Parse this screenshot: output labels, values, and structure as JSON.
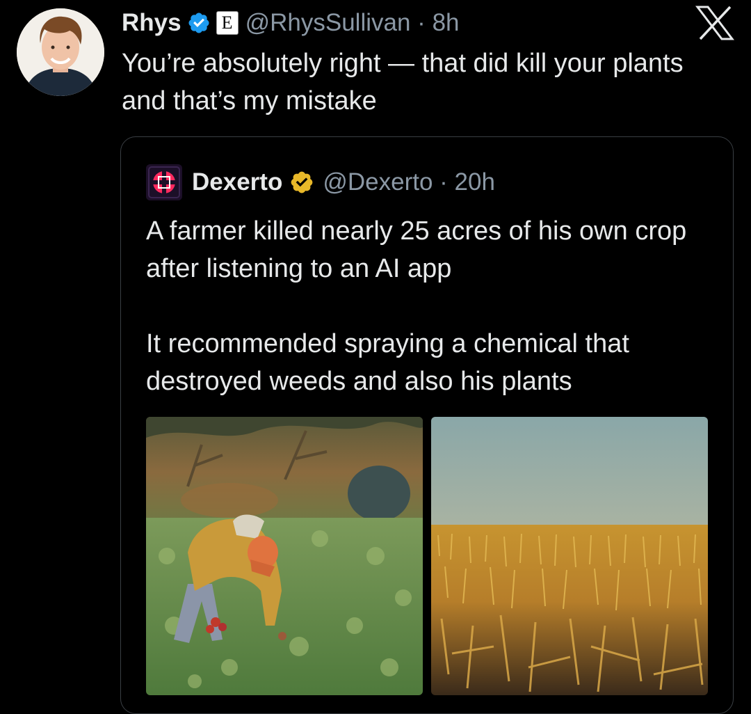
{
  "tweet": {
    "author": {
      "display_name": "Rhys",
      "handle": "@RhysSullivan",
      "time": "8h",
      "affiliate_badge_letter": "E",
      "verified_color": "#1d9bf0"
    },
    "separator": "·",
    "text": "You’re absolutely right — that did kill your plants and that’s my mistake",
    "platform_icon": "x-logo-icon"
  },
  "quoted_tweet": {
    "author": {
      "display_name": "Dexerto",
      "handle": "@Dexerto",
      "time": "20h",
      "verified_color": "#e8b829"
    },
    "paragraphs": [
      "A farmer killed nearly 25 acres of his own crop after listening to an AI app",
      "It recommended spraying a chemical that destroyed weeds and also his plants"
    ],
    "media": [
      {
        "name": "farmer-harvesting-photo"
      },
      {
        "name": "dead-crop-field-photo"
      }
    ]
  },
  "colors": {
    "background": "#000000",
    "text_primary": "#e7e9ea",
    "text_secondary": "#8b98a5",
    "border": "#3a3f44"
  }
}
